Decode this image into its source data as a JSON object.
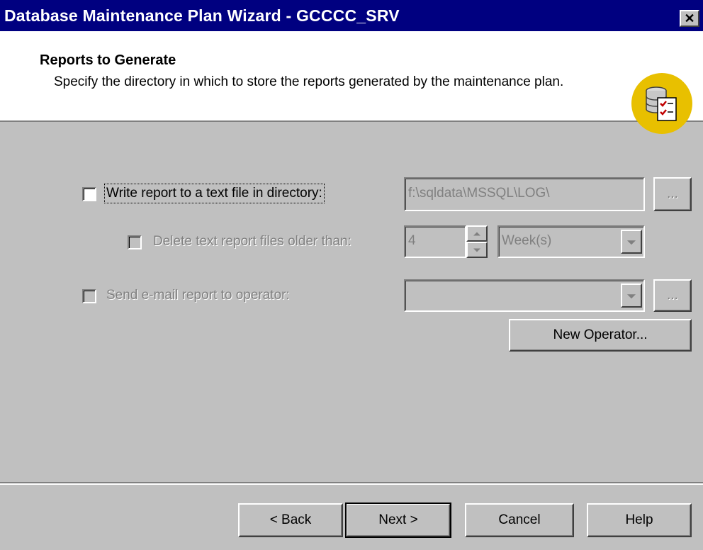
{
  "window": {
    "title": "Database Maintenance Plan Wizard - GCCCC_SRV",
    "close_glyph": "✕"
  },
  "header": {
    "title": "Reports to Generate",
    "description": "Specify the directory in which to store the reports generated by the maintenance plan.",
    "icon": "database-checklist-icon"
  },
  "options": {
    "write_report": {
      "label": "Write report to a text file in directory:",
      "checked": false,
      "directory_value": "f:\\sqldata\\MSSQL\\LOG\\",
      "browse_label": "..."
    },
    "delete_old": {
      "label": "Delete text report files older than:",
      "checked": false,
      "enabled": false,
      "amount_value": "4",
      "unit_value": "Week(s)"
    },
    "email_report": {
      "label": "Send e-mail report to operator:",
      "checked": false,
      "enabled": false,
      "operator_value": "",
      "browse_label": "...",
      "new_operator_label": "New Operator..."
    }
  },
  "footer": {
    "back_label": "< Back",
    "next_label": "Next >",
    "cancel_label": "Cancel",
    "help_label": "Help"
  },
  "colors": {
    "titlebar": "#000080",
    "dialog": "#c0c0c0",
    "icon_circle": "#e8c000"
  }
}
